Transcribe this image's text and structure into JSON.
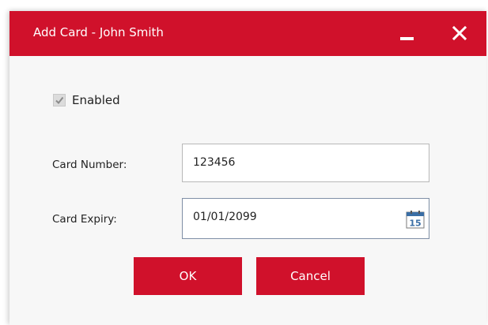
{
  "dialog": {
    "title": "Add Card - John Smith",
    "minimize_icon": "minimize-icon",
    "close_icon": "close-icon"
  },
  "form": {
    "enabled": {
      "label": "Enabled",
      "checked": true
    },
    "card_number": {
      "label": "Card Number:",
      "value": "123456"
    },
    "card_expiry": {
      "label": "Card Expiry:",
      "value": "01/01/2099",
      "calendar_icon": "calendar-icon",
      "calendar_day": "15"
    }
  },
  "buttons": {
    "ok_label": "OK",
    "cancel_label": "Cancel"
  },
  "colors": {
    "accent": "#d0112b",
    "background": "#f7f7f7",
    "calendar_blue": "#3a6ea5"
  }
}
